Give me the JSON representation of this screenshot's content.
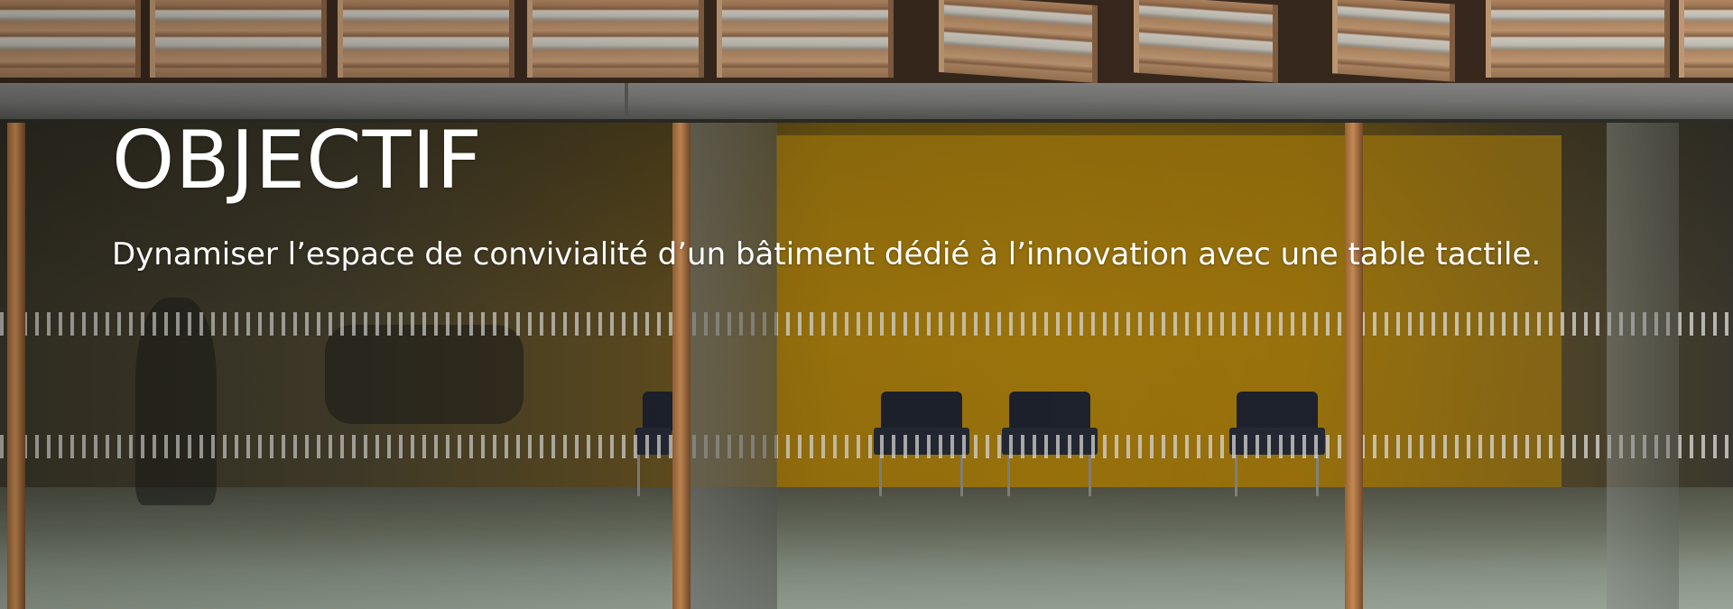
{
  "hero": {
    "title": "OBJECTIF",
    "description": "Dynamiser l’espace de convivialité d’un bâtiment dédié à l’innovation avec une table tactile."
  },
  "colors": {
    "text": "#ffffff",
    "accent_yellow": "#a07a10",
    "wood": "#b58b66"
  },
  "background_image": {
    "subject": "building-facade-photo"
  }
}
